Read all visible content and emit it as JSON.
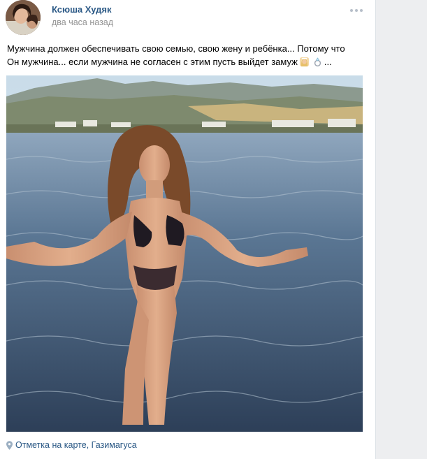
{
  "post": {
    "author_name": "Ксюша Худяк",
    "timestamp": "два часа назад",
    "text_line_1": "Мужчина должен обеспечивать свою семью, свою жену и ребёнка... Потому что",
    "text_line_2": "Он мужчина... если мужчина не согласен с этим пусть выйдет замуж",
    "text_line_2_end": "...",
    "emoji_1": "woman-with-veil-emoji",
    "emoji_2": "ring-emoji",
    "more_icon": "three-dots-icon",
    "location_label": "Отметка на карте, Газимагуса",
    "location_icon": "map-pin-icon"
  },
  "colors": {
    "link": "#2a5885",
    "muted": "#939393",
    "background": "#edeef0"
  }
}
